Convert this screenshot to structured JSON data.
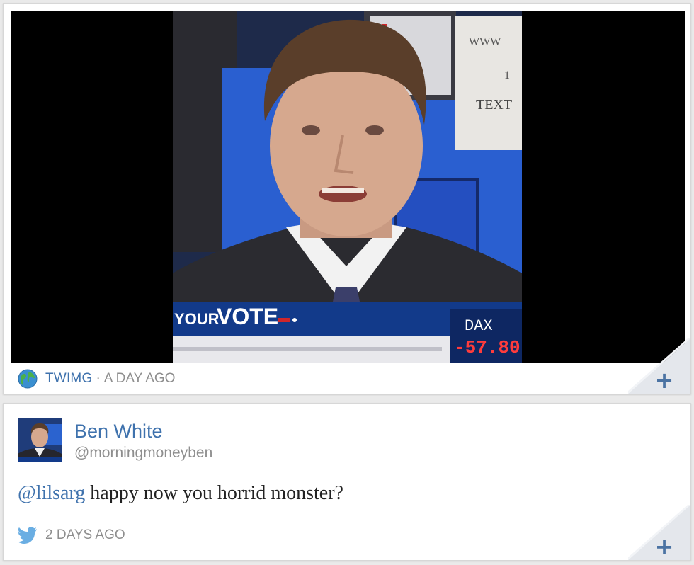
{
  "media_card": {
    "source": "TWIMG",
    "separator": "·",
    "time": "A DAY AGO",
    "video_still": {
      "lower_third": {
        "prefix": "YOUR",
        "main": "VOTE"
      },
      "ticker": {
        "symbol": "DAX",
        "change": "-57.80"
      },
      "background_sign": {
        "line1": "WWW",
        "line2": "1",
        "line3": "TEXT"
      }
    }
  },
  "tweet_card": {
    "author_name": "Ben White",
    "author_handle": "@morningmoneyben",
    "mention": "@lilsarg",
    "text": " happy now you horrid monster?",
    "time": "2 DAYS AGO"
  },
  "actions": {
    "expand_label": "+"
  },
  "colors": {
    "link": "#3f72ad",
    "muted": "#8e8e8e",
    "twitter_bird": "#6aaee3"
  }
}
